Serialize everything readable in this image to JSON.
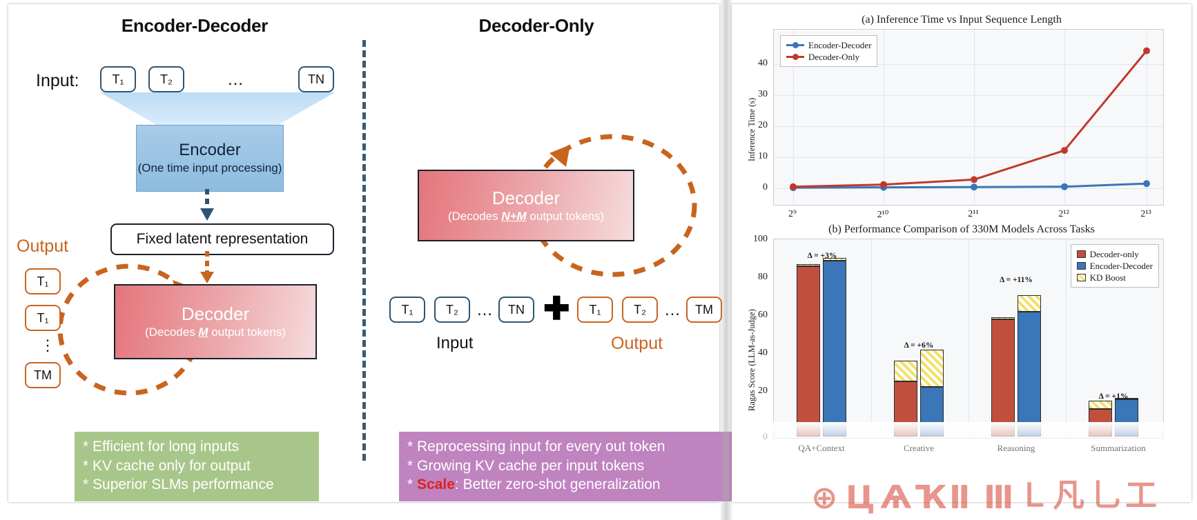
{
  "diagram": {
    "left": {
      "title": "Encoder-Decoder",
      "input_label": "Input:",
      "input_tokens": [
        "T₁",
        "T₂",
        "TN"
      ],
      "input_ellipsis": "…",
      "encoder_title": "Encoder",
      "encoder_subtitle": "(One time input processing)",
      "latent_label": "Fixed latent representation",
      "output_label": "Output",
      "output_tokens": [
        "T₁",
        "T₁",
        "TM"
      ],
      "output_vdots": "⋮",
      "decoder_title": "Decoder",
      "decoder_subtitle_pre": "(Decodes ",
      "decoder_subtitle_em": "M",
      "decoder_subtitle_post": " output tokens)",
      "notes": [
        "* Efficient for long inputs",
        "* KV cache only for output",
        "* Superior SLMs performance"
      ]
    },
    "right": {
      "title": "Decoder-Only",
      "decoder_title": "Decoder",
      "decoder_subtitle_pre": "(Decodes ",
      "decoder_subtitle_em": "N+M",
      "decoder_subtitle_post": " output tokens)",
      "input_tokens": [
        "T₁",
        "T₂",
        "TN"
      ],
      "output_tokens": [
        "T₁",
        "T₂",
        "TM"
      ],
      "ellipsis": "…",
      "plus_symbol": "✚",
      "input_label": "Input",
      "output_label": "Output",
      "notes_line1": "* Reprocessing input for every out token",
      "notes_line2": "* Growing KV cache per input tokens",
      "notes_line3_pre": "* ",
      "notes_line3_hot": "Scale",
      "notes_line3_post": ": Better zero-shot generalization"
    }
  },
  "chart_data": [
    {
      "type": "line",
      "title": "(a) Inference Time vs Input Sequence Length",
      "xlabel": "",
      "ylabel": "Inference Time (s)",
      "x_ticklabels": [
        "2⁹",
        "2¹⁰",
        "2¹¹",
        "2¹²",
        "2¹³"
      ],
      "x": [
        9,
        10,
        11,
        12,
        13
      ],
      "ylim": [
        -2,
        47
      ],
      "y_ticks": [
        0,
        10,
        20,
        30,
        40
      ],
      "grid": true,
      "legend_position": "upper left",
      "series": [
        {
          "name": "Encoder-Decoder",
          "color": "#3a76b8",
          "values": [
            0.2,
            0.3,
            0.4,
            0.5,
            1.5
          ]
        },
        {
          "name": "Decoder-Only",
          "color": "#c0392b",
          "values": [
            0.5,
            1.2,
            2.8,
            12.2,
            44.3
          ]
        }
      ]
    },
    {
      "type": "bar",
      "title": "(b) Performance Comparison of 330M Models Across Tasks",
      "xlabel": "",
      "ylabel": "Ragas Score (LLM-as-Judge)",
      "categories": [
        "QA+Context",
        "Creative",
        "Reasoning",
        "Summarization"
      ],
      "ylim": [
        0,
        100
      ],
      "y_ticks": [
        0,
        20,
        40,
        60,
        80,
        100
      ],
      "legend_position": "upper right",
      "legend_entries": [
        "Decoder-only",
        "Encoder-Decoder",
        "KD Boost"
      ],
      "colors": {
        "decoder_only": "#c0503d",
        "encoder_decoder": "#3a76b8",
        "kd_boost": "#f2e06a"
      },
      "series": [
        {
          "name": "Decoder-only",
          "base": [
            89.5,
            29.0,
            61.5,
            14.5
          ],
          "kd_boost": [
            1.0,
            11.0,
            1.0,
            4.5
          ]
        },
        {
          "name": "Encoder-Decoder",
          "base": [
            92.5,
            26.0,
            65.5,
            19.5
          ],
          "kd_boost": [
            1.5,
            19.5,
            8.5,
            0.5
          ]
        }
      ],
      "annotations": [
        "Δ = +3%",
        "Δ = +6%",
        "Δ = +11%",
        "Δ = +1%"
      ]
    }
  ]
}
